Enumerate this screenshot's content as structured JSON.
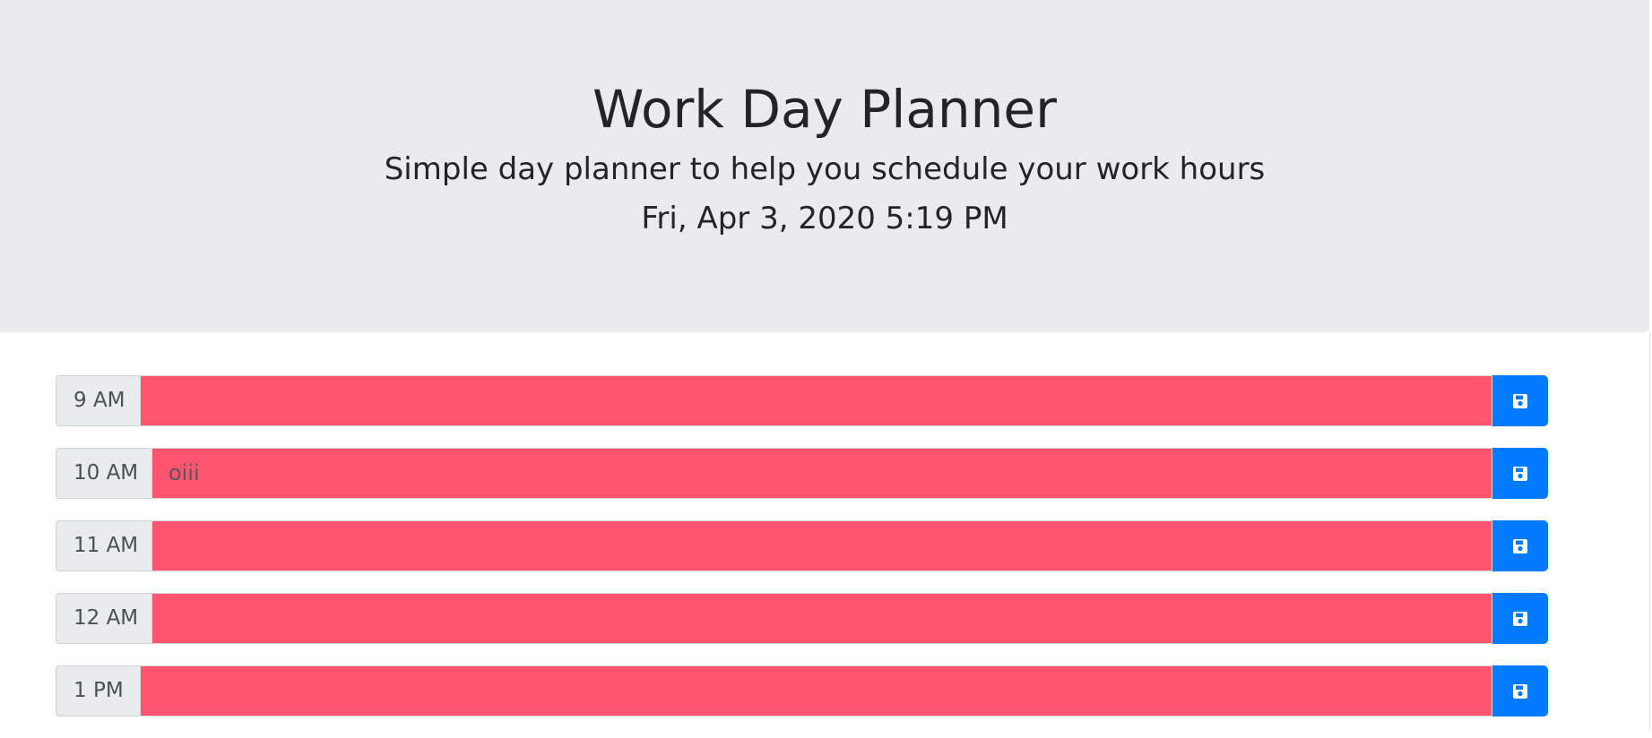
{
  "header": {
    "title": "Work Day Planner",
    "lead": "Simple day planner to help you schedule your work hours",
    "current_date": "Fri, Apr 3, 2020 5:19 PM"
  },
  "colors": {
    "past_slot": "#ff5470",
    "save_button": "#007bff",
    "jumbotron_bg": "#e9ecef"
  },
  "save_icon": "save-icon",
  "hours": [
    {
      "label": "9 AM",
      "text": ""
    },
    {
      "label": "10 AM",
      "text": "oiii"
    },
    {
      "label": "11 AM",
      "text": ""
    },
    {
      "label": "12 AM",
      "text": ""
    },
    {
      "label": "1 PM",
      "text": ""
    }
  ]
}
